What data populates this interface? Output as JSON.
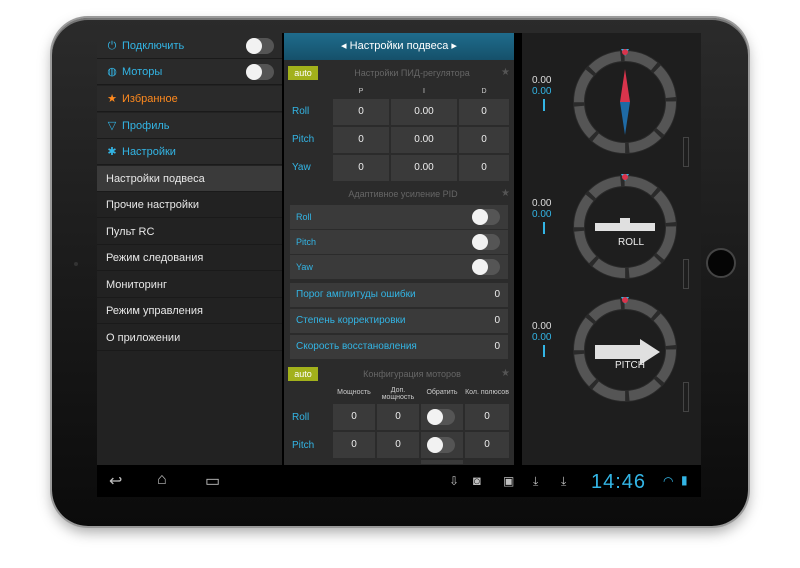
{
  "sidebar": {
    "headers": [
      {
        "label": "Подключить",
        "icon": "plug-icon",
        "toggle": false
      },
      {
        "label": "Моторы",
        "icon": "motor-icon",
        "toggle": false
      },
      {
        "label": "Избранное",
        "icon": "star-icon"
      },
      {
        "label": "Профиль",
        "icon": "filter-icon"
      },
      {
        "label": "Настройки",
        "icon": "gear-icon"
      }
    ],
    "items": [
      "Настройки подвеса",
      "Прочие настройки",
      "Пульт RC",
      "Режим следования",
      "Мониторинг",
      "Режим управления",
      "О приложении"
    ]
  },
  "panel": {
    "title": "Настройки подвеса",
    "pid": {
      "auto_label": "auto",
      "section_label": "Настройки ПИД-регулятора",
      "columns": [
        "P",
        "I",
        "D"
      ],
      "rows": [
        {
          "label": "Roll",
          "p": "0",
          "i": "0.00",
          "d": "0"
        },
        {
          "label": "Pitch",
          "p": "0",
          "i": "0.00",
          "d": "0"
        },
        {
          "label": "Yaw",
          "p": "0",
          "i": "0.00",
          "d": "0"
        }
      ]
    },
    "adaptive": {
      "section_label": "Адаптивное усиление PID",
      "toggles": [
        {
          "label": "Roll",
          "on": false
        },
        {
          "label": "Pitch",
          "on": false
        },
        {
          "label": "Yaw",
          "on": false
        }
      ],
      "values": [
        {
          "label": "Порог амплитуды ошибки",
          "value": "0"
        },
        {
          "label": "Степень корректировки",
          "value": "0"
        },
        {
          "label": "Скорость восстановления",
          "value": "0"
        }
      ]
    },
    "motors": {
      "auto_label": "auto",
      "section_label": "Конфигурация моторов",
      "columns": [
        "Мощность",
        "Доп. мощность",
        "Обратить",
        "Кол. полюсов"
      ],
      "rows": [
        {
          "label": "Roll",
          "power": "0",
          "extra": "0",
          "reverse": false,
          "poles": "0"
        },
        {
          "label": "Pitch",
          "power": "0",
          "extra": "0",
          "reverse": false,
          "poles": "0"
        }
      ]
    }
  },
  "gauges": [
    {
      "name": "yaw",
      "label": "",
      "value_white": "0.00",
      "value_blue": "0.00",
      "icon": "compass-needle-icon"
    },
    {
      "name": "roll",
      "label": "ROLL",
      "value_white": "0.00",
      "value_blue": "0.00",
      "icon": "roll-bar-icon"
    },
    {
      "name": "pitch",
      "label": "PITCH",
      "value_white": "0.00",
      "value_blue": "0.00",
      "icon": "pitch-arrow-icon"
    }
  ],
  "navbar": {
    "icons": [
      "back-icon",
      "home-icon",
      "recent-apps-icon",
      "usb-icon",
      "camera-icon",
      "gift-icon",
      "download-icon",
      "download-icon",
      "wifi-icon",
      "battery-icon"
    ],
    "time": "14:46"
  },
  "colors": {
    "accent": "#33b5e5",
    "favorite": "#ff8a1e",
    "auto": "#a2b11b",
    "title_bar": "#1a5f7c"
  }
}
